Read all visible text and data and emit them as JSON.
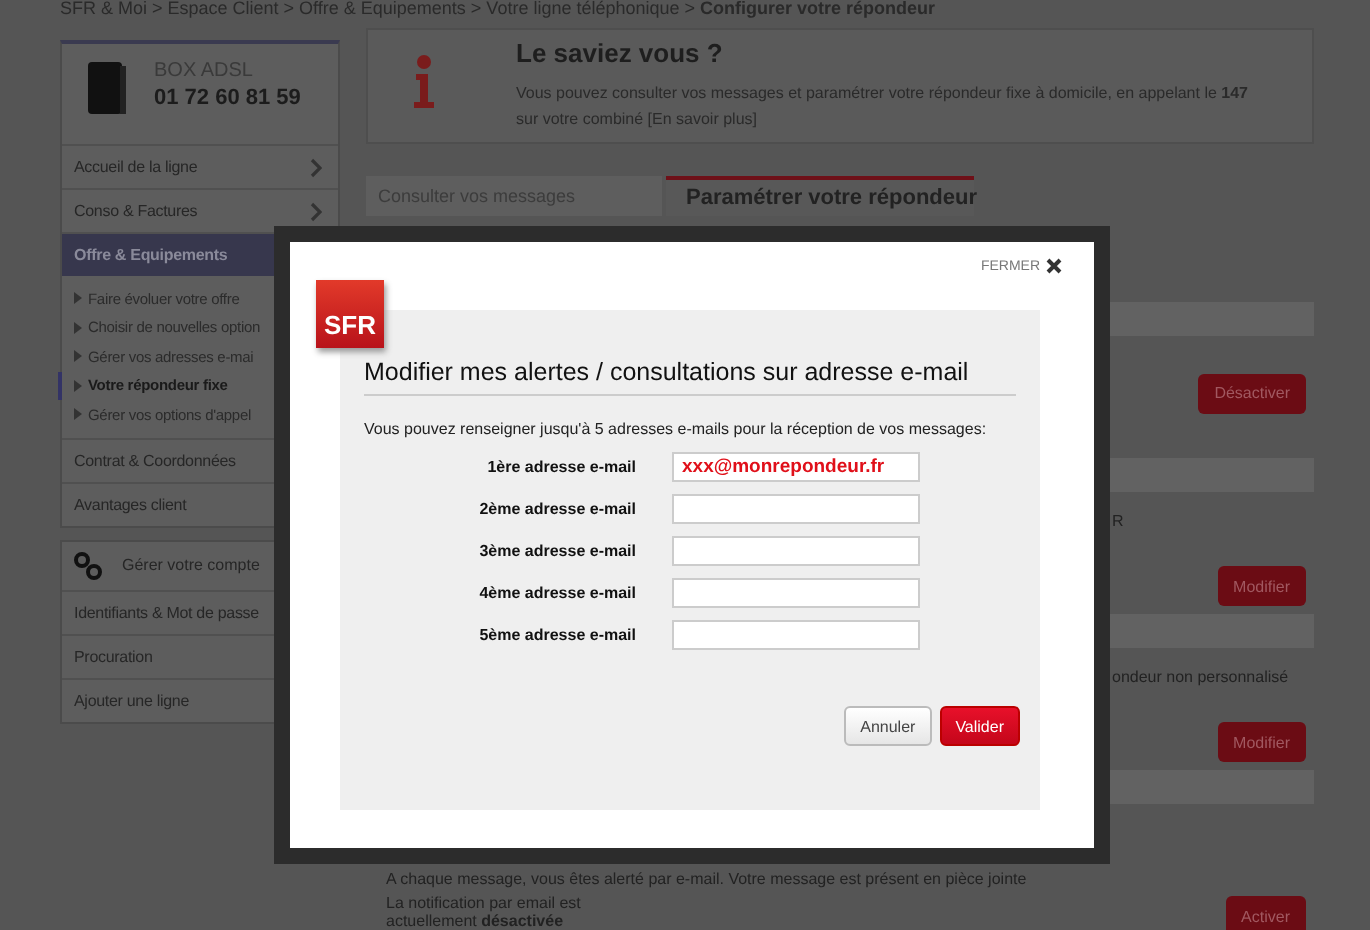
{
  "breadcrumb": {
    "path": "SFR & Moi > Espace Client > Offre & Equipements > Votre ligne téléphonique > ",
    "current": "Configurer votre répondeur"
  },
  "line_card": {
    "label": "BOX ADSL",
    "number": "01 72 60 81 59"
  },
  "nav": [
    {
      "label": "Accueil de la ligne",
      "selected": false,
      "has_arrow": true
    },
    {
      "label": "Conso & Factures",
      "selected": false,
      "has_arrow": true
    },
    {
      "label": "Offre & Equipements",
      "selected": true,
      "has_arrow": false,
      "children": [
        {
          "label": "Faire évoluer votre offre",
          "selected": false
        },
        {
          "label": "Choisir de nouvelles option",
          "selected": false
        },
        {
          "label": "Gérer vos adresses e-mai",
          "selected": false
        },
        {
          "label": "Votre répondeur fixe",
          "selected": true
        },
        {
          "label": "Gérer vos options d'appel",
          "selected": false
        }
      ]
    },
    {
      "label": "Contrat & Coordonnées",
      "selected": false,
      "has_arrow": false
    },
    {
      "label": "Avantages client",
      "selected": false,
      "has_arrow": false
    }
  ],
  "account": {
    "title": "Gérer votre compte",
    "items": [
      "Identifiants & Mot de passe",
      "Procuration",
      "Ajouter une ligne"
    ]
  },
  "info": {
    "title": "Le saviez vous ?",
    "text": "Vous pouvez consulter vos messages et paramétrer votre répondeur fixe à domicile, en appelant le **147** sur votre combiné [En savoir plus]"
  },
  "tabs": [
    {
      "label": "Consulter vos messages",
      "selected": false
    },
    {
      "label": "Paramétrer votre répondeur",
      "selected": true
    }
  ],
  "sections": [
    {
      "kind": "hidden",
      "button": "Désactiver"
    },
    {
      "kind": "right",
      "lines": [
        "R"
      ],
      "button": "Modifier"
    },
    {
      "kind": "right",
      "lines": [
        "ondeur non personnalisé"
      ],
      "button": "Modifier"
    },
    {
      "kind": "left",
      "lines": [
        "A chaque message, vous êtes alerté par e-mail. Votre message est présent en pièce jointe",
        "La notification par email est",
        "actuellement **désactivée**"
      ],
      "button": "Activer"
    }
  ],
  "modal": {
    "close_label": "FERMER",
    "logo": "SFR",
    "title": "Modifier mes alertes / consultations sur adresse e-mail",
    "intro": "Vous pouvez renseigner jusqu'à 5 adresses e-mails pour la réception de vos messages:",
    "fields": [
      {
        "label": "1ère adresse e-mail",
        "value": "xxx@monrepondeur.fr"
      },
      {
        "label": "2ème adresse e-mail"
      },
      {
        "label": "3ème adresse e-mail"
      },
      {
        "label": "4ème adresse e-mail"
      },
      {
        "label": "5ème adresse e-mail"
      }
    ],
    "buttons": [
      {
        "label": "Annuler",
        "kind": "secondary"
      },
      {
        "label": "Valider",
        "kind": "primary"
      }
    ]
  }
}
